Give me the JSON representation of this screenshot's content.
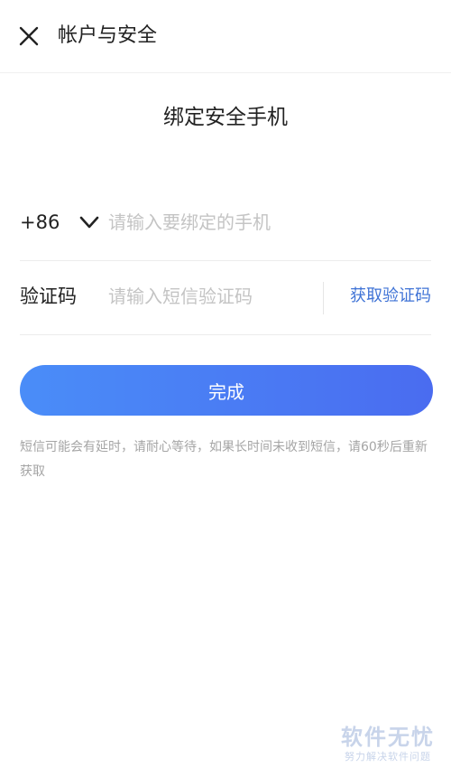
{
  "header": {
    "title": "帐户与安全",
    "close_icon": "close-icon"
  },
  "page": {
    "title": "绑定安全手机"
  },
  "phone_row": {
    "country_code": "+86",
    "dropdown_icon": "chevron-down-icon",
    "placeholder": "请输入要绑定的手机",
    "value": ""
  },
  "code_row": {
    "label": "验证码",
    "placeholder": "请输入短信验证码",
    "value": "",
    "get_code_label": "获取验证码"
  },
  "submit": {
    "label": "完成"
  },
  "hint": {
    "text": "短信可能会有延时，请耐心等待，如果长时间未收到短信，请60秒后重新获取"
  },
  "watermark": {
    "main": "软件无忧",
    "sub": "努力解决软件问题"
  },
  "colors": {
    "accent": "#3f73d6",
    "button_gradient_start": "#4a8df8",
    "button_gradient_end": "#4a6cf0",
    "placeholder": "#c4c4c4",
    "hint": "#a5a5a5"
  }
}
